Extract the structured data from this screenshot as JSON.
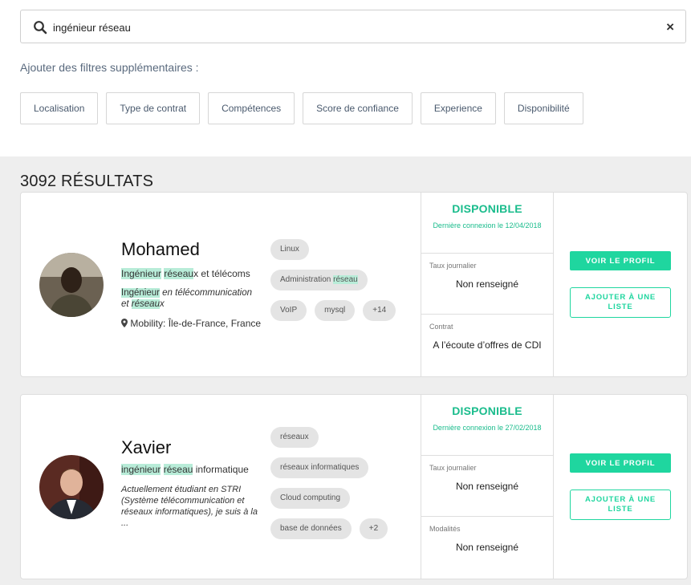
{
  "search": {
    "value": "ingénieur réseau",
    "clear_icon": "×"
  },
  "filters": {
    "title": "Ajouter des filtres supplémentaires :",
    "items": [
      "Localisation",
      "Type de contrat",
      "Compétences",
      "Score de confiance",
      "Experience",
      "Disponibilité"
    ]
  },
  "results": {
    "count_label": "3092 RÉSULTATS"
  },
  "candidates": [
    {
      "name": "Mohamed",
      "title_parts": [
        "Ingénieur",
        " ",
        "réseau",
        "x et télécoms"
      ],
      "desc_parts": [
        "Ingénieur",
        " en télécommunication et ",
        "réseau",
        "x"
      ],
      "mobility": "Mobility: Île-de-France, France",
      "tags": [
        "Linux",
        "Administration ",
        "réseau",
        "VoIP",
        "mysql",
        "+14"
      ],
      "status": "DISPONIBLE",
      "last_login": "Dernière connexion le 12/04/2018",
      "box1_label": "Taux journalier",
      "box1_value": "Non renseigné",
      "box2_label": "Contrat",
      "box2_value": "A l’écoute d’offres de CDI",
      "view_label": "VOIR LE PROFIL",
      "add_label": "AJOUTER À UNE LISTE"
    },
    {
      "name": "Xavier",
      "title_parts": [
        "ingénieur",
        " ",
        "réseau",
        " informatique"
      ],
      "desc": "Actuellement étudiant en STRI (Système télécommunication et réseaux informatiques), je suis à la ...",
      "tags": [
        "réseaux",
        "réseaux informatiques",
        "Cloud computing",
        "base de données",
        "+2"
      ],
      "status": "DISPONIBLE",
      "last_login": "Dernière connexion le 27/02/2018",
      "box1_label": "Taux journalier",
      "box1_value": "Non renseigné",
      "box2_label": "Modalités",
      "box2_value": "Non renseigné",
      "view_label": "VOIR LE PROFIL",
      "add_label": "AJOUTER À UNE LISTE"
    }
  ],
  "icons": {
    "search": "search-icon",
    "location": "map-marker-icon",
    "close": "close-icon"
  },
  "colors": {
    "accent": "#1fd69f",
    "highlight": "#b8ecd8",
    "background": "#eeeeee"
  }
}
